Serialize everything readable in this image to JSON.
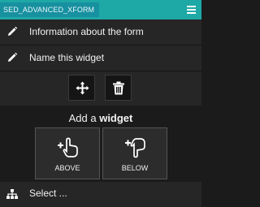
{
  "header": {
    "title": "SED_ADVANCED_XFORM",
    "menu_icon": "hamburger-menu-icon",
    "color": "#1ea8a6"
  },
  "menu": {
    "items": [
      {
        "label": "Information about the form",
        "icon": "pencil-icon"
      },
      {
        "label": "Name this widget",
        "icon": "pencil-icon"
      }
    ]
  },
  "tools": {
    "move_icon": "move-arrows-icon",
    "delete_icon": "trash-icon"
  },
  "add_widget": {
    "title_prefix": "Add a ",
    "title_emphasis": "widget",
    "above_label": "ABOVE",
    "below_label": "BELOW",
    "above_icon": "add-above-hand-icon",
    "below_icon": "add-below-hand-icon"
  },
  "select": {
    "label": "Select ...",
    "icon": "sitemap-icon"
  }
}
